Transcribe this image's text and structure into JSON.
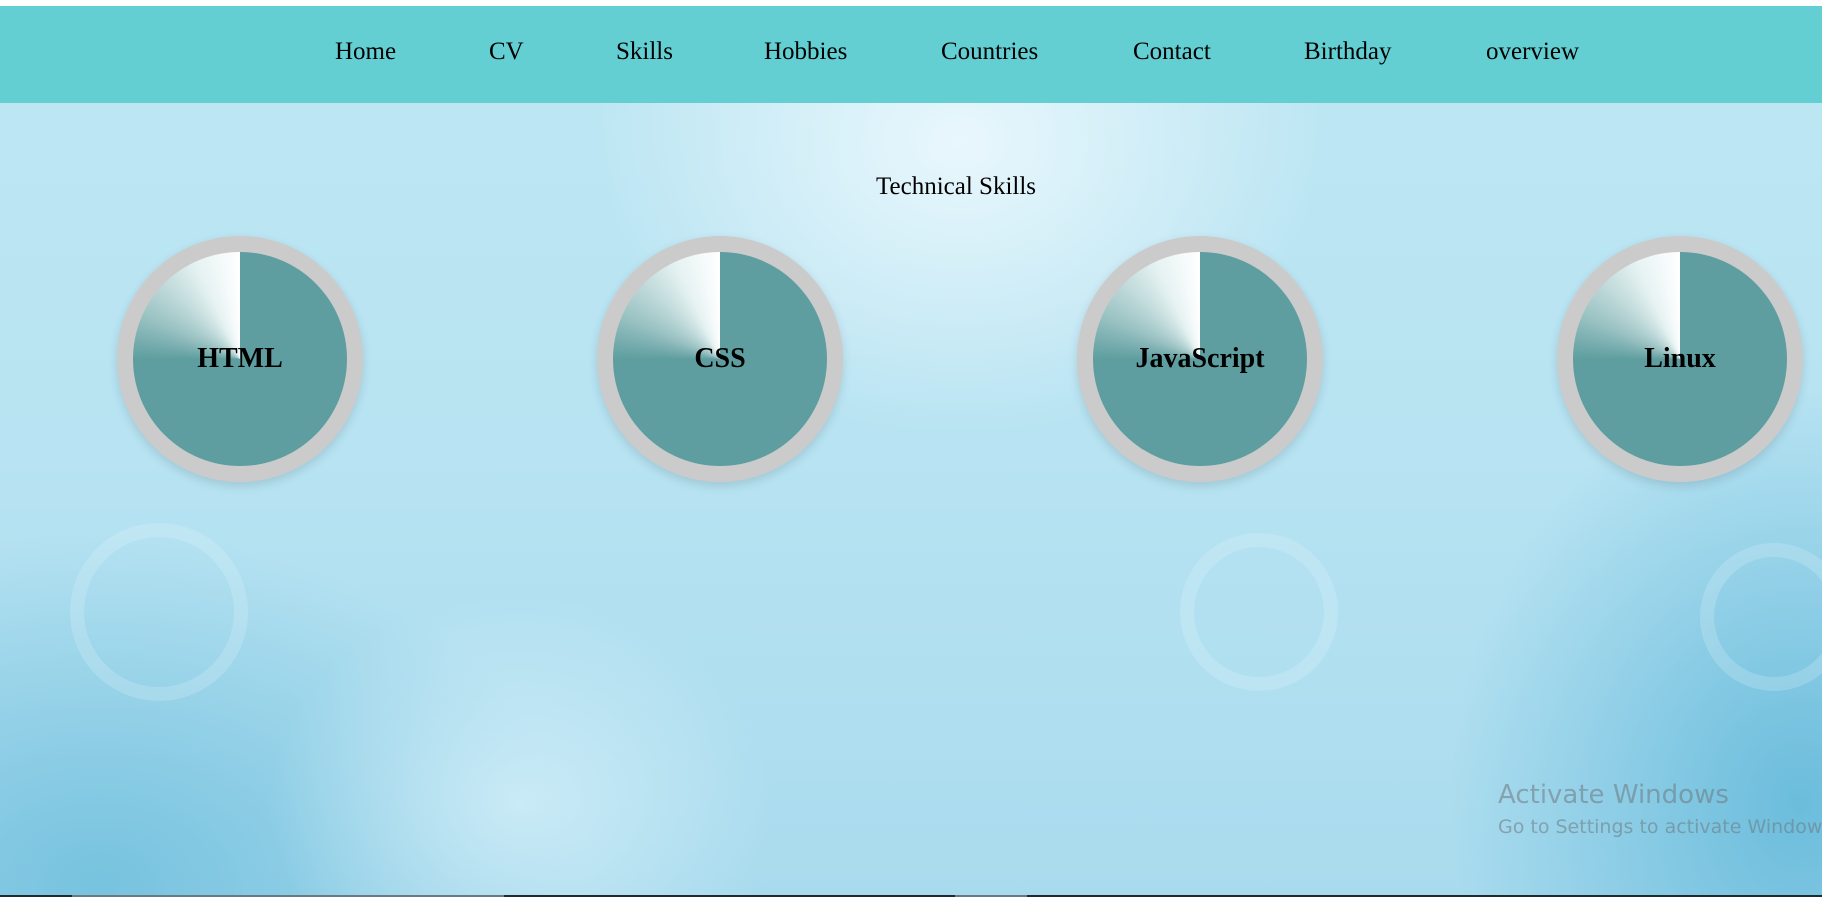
{
  "nav": {
    "items": [
      {
        "label": "Home"
      },
      {
        "label": "CV"
      },
      {
        "label": "Skills"
      },
      {
        "label": "Hobbies"
      },
      {
        "label": "Countries"
      },
      {
        "label": "Contact"
      },
      {
        "label": "Birthday"
      },
      {
        "label": "overview"
      }
    ]
  },
  "page": {
    "title": "Technical Skills"
  },
  "skills": [
    {
      "label": "HTML",
      "level_percent": 75
    },
    {
      "label": "CSS",
      "level_percent": 75
    },
    {
      "label": "JavaScript",
      "level_percent": 75
    },
    {
      "label": "Linux",
      "level_percent": 75
    }
  ],
  "colors": {
    "navbar": "#63cfd3",
    "pie_fill": "#5f9ea0",
    "ring": "#cbcbcb"
  },
  "watermark": {
    "line1": "Activate Windows",
    "line2": "Go to Settings to activate Windows."
  }
}
